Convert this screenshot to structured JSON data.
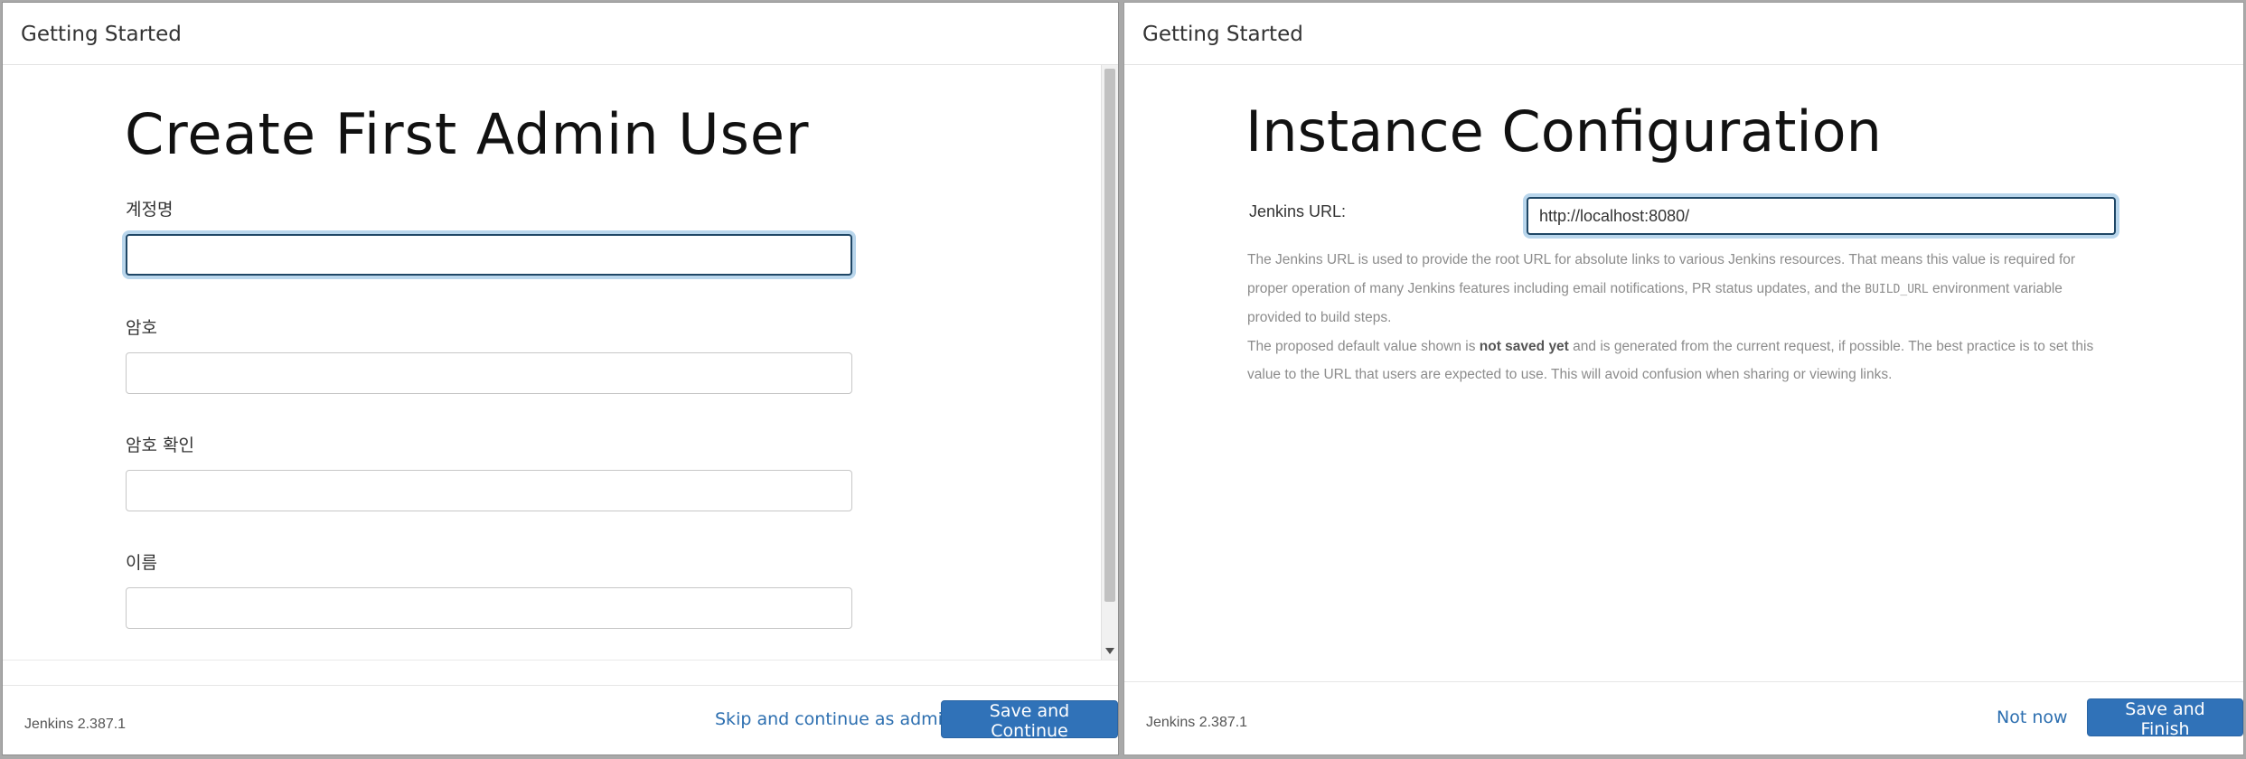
{
  "left_panel": {
    "header_title": "Getting Started",
    "page_title": "Create First Admin User",
    "fields": [
      {
        "label": "계정명",
        "value": ""
      },
      {
        "label": "암호",
        "value": ""
      },
      {
        "label": "암호 확인",
        "value": ""
      },
      {
        "label": "이름",
        "value": ""
      }
    ],
    "footer": {
      "version": "Jenkins 2.387.1",
      "skip_label": "Skip and continue as admin",
      "save_label": "Save and Continue"
    }
  },
  "right_panel": {
    "header_title": "Getting Started",
    "page_title": "Instance Configuration",
    "url_label": "Jenkins URL:",
    "url_value": "http://localhost:8080/",
    "help": {
      "p1_before": "The Jenkins URL is used to provide the root URL for absolute links to various Jenkins resources. That means this value is required for proper operation of many Jenkins features including email notifications, PR status updates, and the ",
      "p1_code": "BUILD_URL",
      "p1_after": " environment variable provided to build steps.",
      "p2_before": "The proposed default value shown is ",
      "p2_bold": "not saved yet",
      "p2_after": " and is generated from the current request, if possible. The best practice is to set this value to the URL that users are expected to use. This will avoid confusion when sharing or viewing links."
    },
    "footer": {
      "version": "Jenkins 2.387.1",
      "not_now_label": "Not now",
      "save_label": "Save and Finish"
    }
  },
  "colors": {
    "primary": "#3072b8",
    "link": "#2d6fb0",
    "focus_ring": "#b9d6ec"
  }
}
